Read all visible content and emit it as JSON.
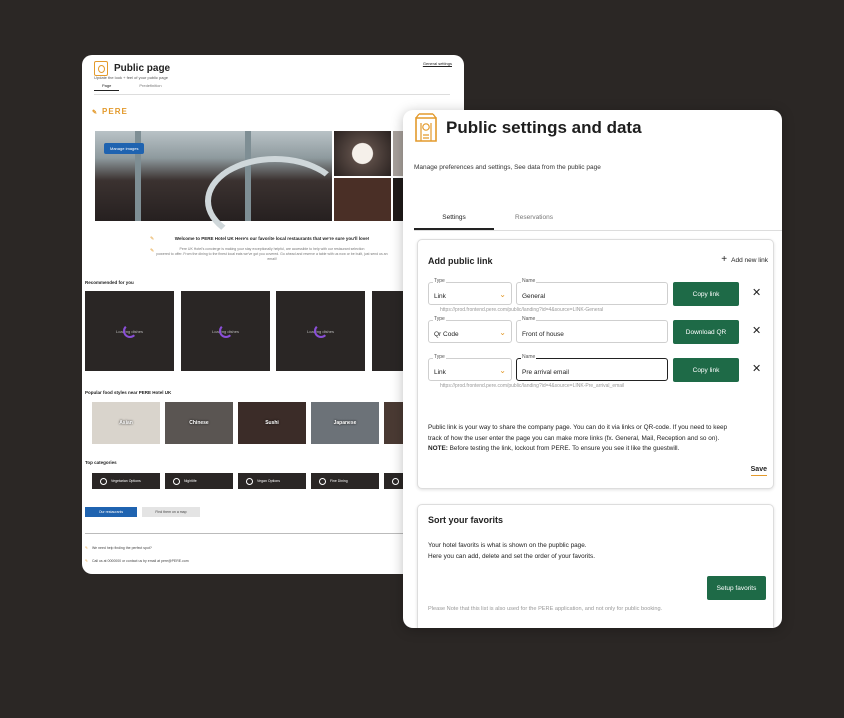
{
  "back": {
    "title": "Public page",
    "subtitle": "Update the look + feel of your public page",
    "general_link": "General settings",
    "tabs": [
      "Page",
      "Predefinition"
    ],
    "brand": "PERE",
    "manage_label": "Manage images",
    "welcome_title": "Welcome to PERE Hotel UK Here's our favorite local restaurants that we're sure you'll love!",
    "welcome_desc_1": "Pere UK Hotel's concierge is making your stay exceptionally helpful, are accessible to help with our restaurant selection",
    "welcome_desc_2": "powered to offer. From the dining to the finest local eats we've got you covered. Go ahead and reserve a table with us now or be built, just send us an email!",
    "recommended_heading": "Recommended for you",
    "loading_label": "Loading dishes",
    "food_heading": "Popular food styles near PERE Hotel UK",
    "food_styles": [
      "Asian",
      "Chinese",
      "Sushi",
      "Japanese"
    ],
    "top_categories_heading": "Top categories",
    "categories": [
      "Vegetarian Options",
      "Nightlife",
      "Vegan Options",
      "Fine Dining"
    ],
    "btn_primary": "Our restaurants",
    "btn_secondary": "Find them on a map",
    "question": "We need help finding the perfect spot?",
    "contact": "Call us at 0000000 or contact us by email at pere@PERE.com"
  },
  "front": {
    "title": "Public settings and data",
    "description": "Manage preferences and settings, See data from the public page",
    "tabs": [
      "Settings",
      "Reservations"
    ],
    "add_public_link": {
      "title": "Add public link",
      "add_new_label": "Add new link",
      "rows": [
        {
          "type_label": "Type",
          "type_value": "Link",
          "name_label": "Name",
          "name_value": "General",
          "url": "https://prod.frontend.pere.com/public/landing?id=4&source=LINK-General",
          "button": "Copy link"
        },
        {
          "type_label": "Type",
          "type_value": "Qr Code",
          "name_label": "Name",
          "name_value": "Front of house",
          "url": "",
          "button": "Download QR"
        },
        {
          "type_label": "Type",
          "type_value": "Link",
          "name_label": "Name",
          "name_value": "Pre arrival email",
          "url": "https://prod.frontend.pere.com/public/landing?id=4&source=LINK-Pre_arrival_email",
          "button": "Copy link"
        }
      ],
      "info_line_1": "Public link is your way to share the company page. You can do it via links or QR-code. If you need to keep",
      "info_line_2": "track of how the user enter the page you can make more links (fx. General, Mail, Reception and so on).",
      "note_label": "NOTE:",
      "note_text": " Before testing the link, lockout from PERE. To ensure you see it like the guestwill.",
      "save_label": "Save"
    },
    "sort_favorites": {
      "title": "Sort your favorits",
      "desc_1": "Your hotel favorits is what is shown on the pupblic page.",
      "desc_2": "Here you can add, delete and set the order of your favorits.",
      "button": "Setup favorits",
      "note": "Please Note that this list is also used for the PERE application, and not only for public booking."
    }
  },
  "colors": {
    "background": "#2b2725",
    "accent": "#e39a2c",
    "green": "#1e6a47",
    "blue": "#1f63b0"
  }
}
